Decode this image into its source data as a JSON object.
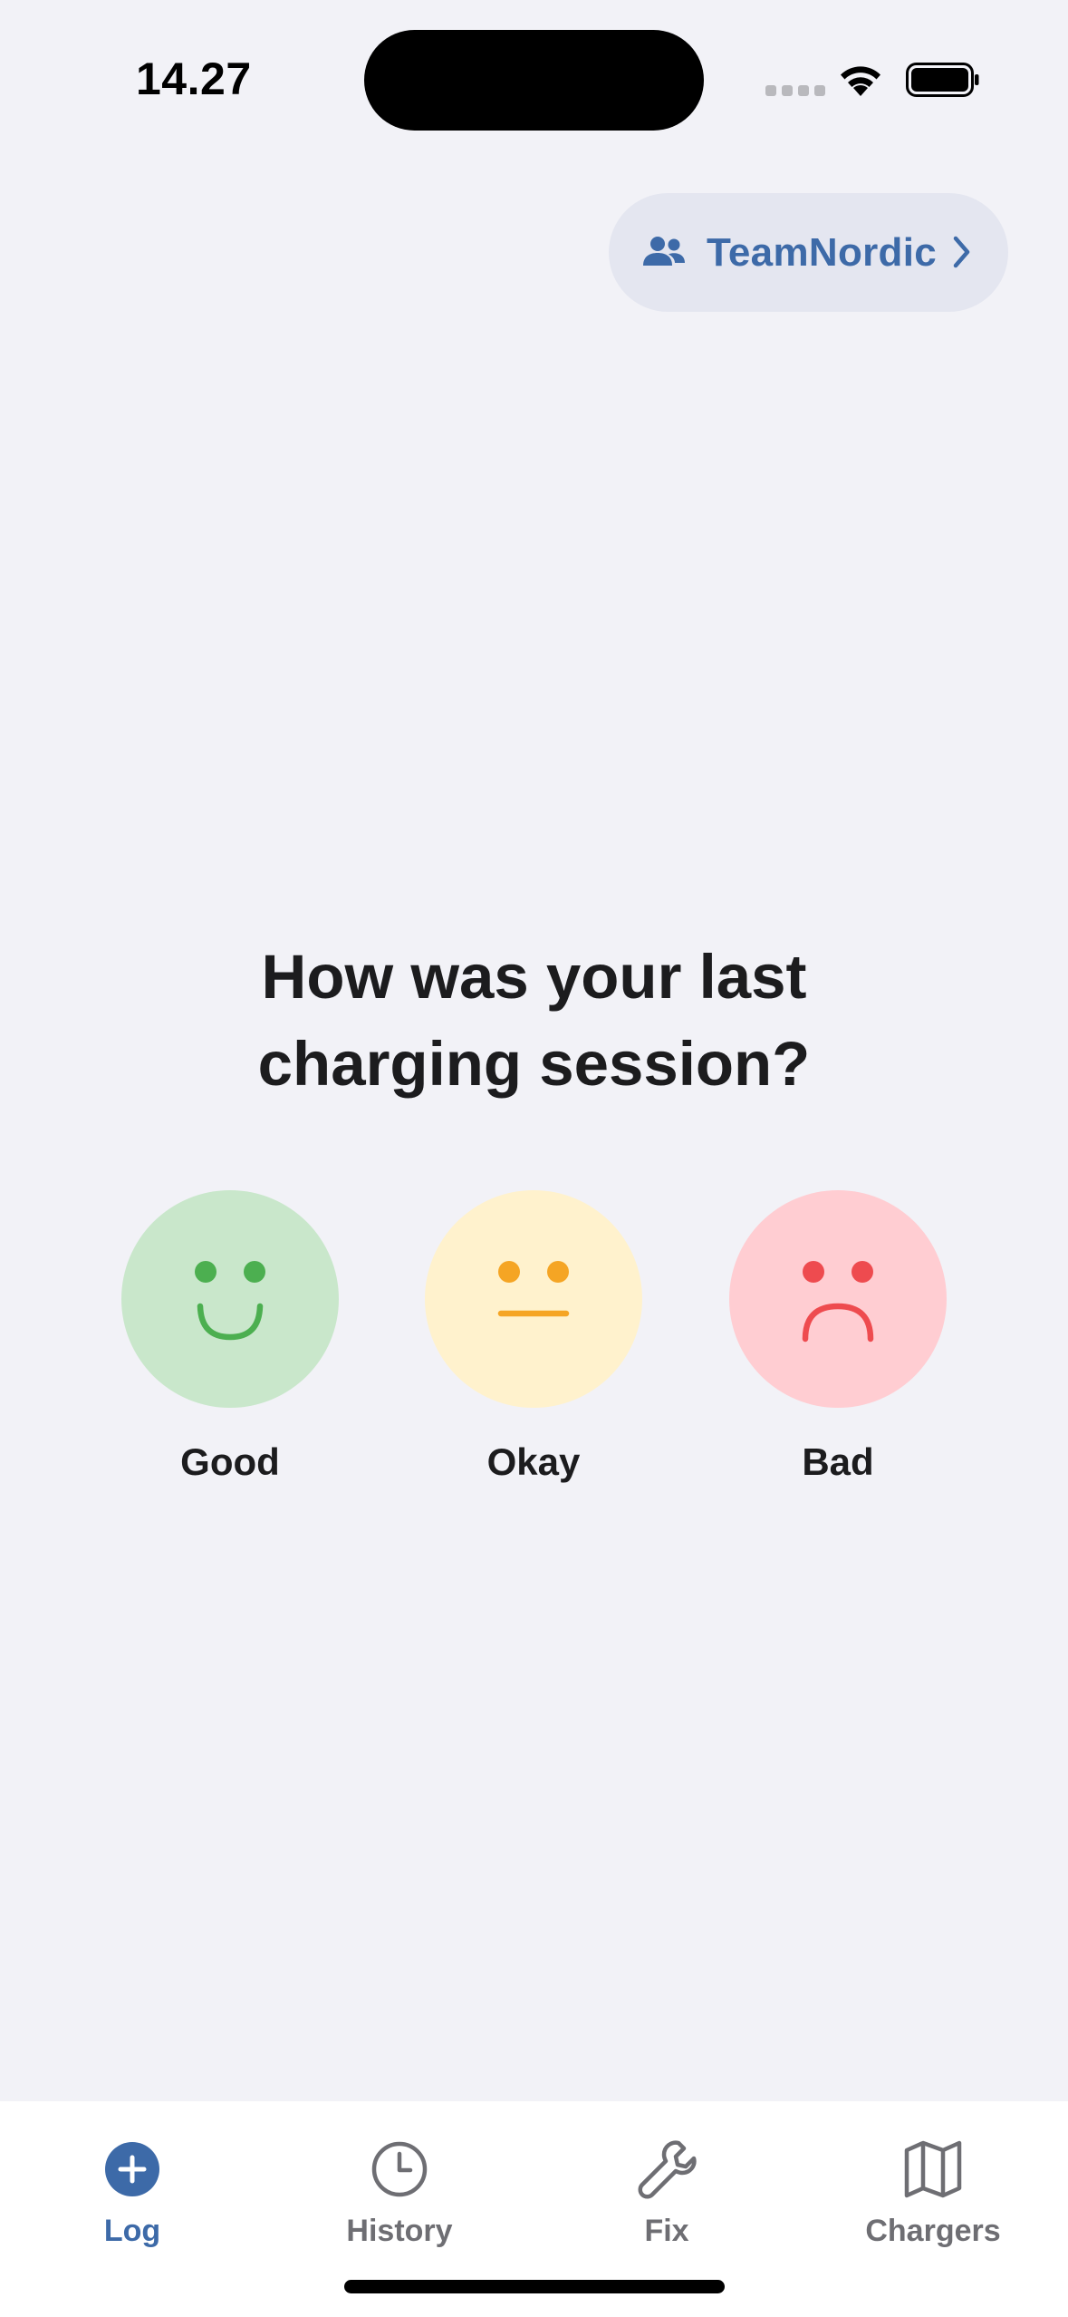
{
  "status_bar": {
    "time": "14.27"
  },
  "team": {
    "name": "TeamNordic",
    "icon": "people-icon"
  },
  "prompt": {
    "question_line1": "How was your last",
    "question_line2": "charging session?"
  },
  "ratings": [
    {
      "label": "Good",
      "icon": "happy-face-icon",
      "bg": "#c9e7cb",
      "fg": "#4caf50"
    },
    {
      "label": "Okay",
      "icon": "neutral-face-icon",
      "bg": "#fff2cd",
      "fg": "#f5a524"
    },
    {
      "label": "Bad",
      "icon": "sad-face-icon",
      "bg": "#ffcdd2",
      "fg": "#ee4b4f"
    }
  ],
  "tabs": [
    {
      "label": "Log",
      "icon": "plus-circle-icon",
      "active": true
    },
    {
      "label": "History",
      "icon": "clock-icon",
      "active": false
    },
    {
      "label": "Fix",
      "icon": "wrench-icon",
      "active": false
    },
    {
      "label": "Chargers",
      "icon": "map-icon",
      "active": false
    }
  ],
  "colors": {
    "accent": "#3d6aa8",
    "background": "#f2f2f7",
    "tab_inactive": "#6e6e73"
  }
}
